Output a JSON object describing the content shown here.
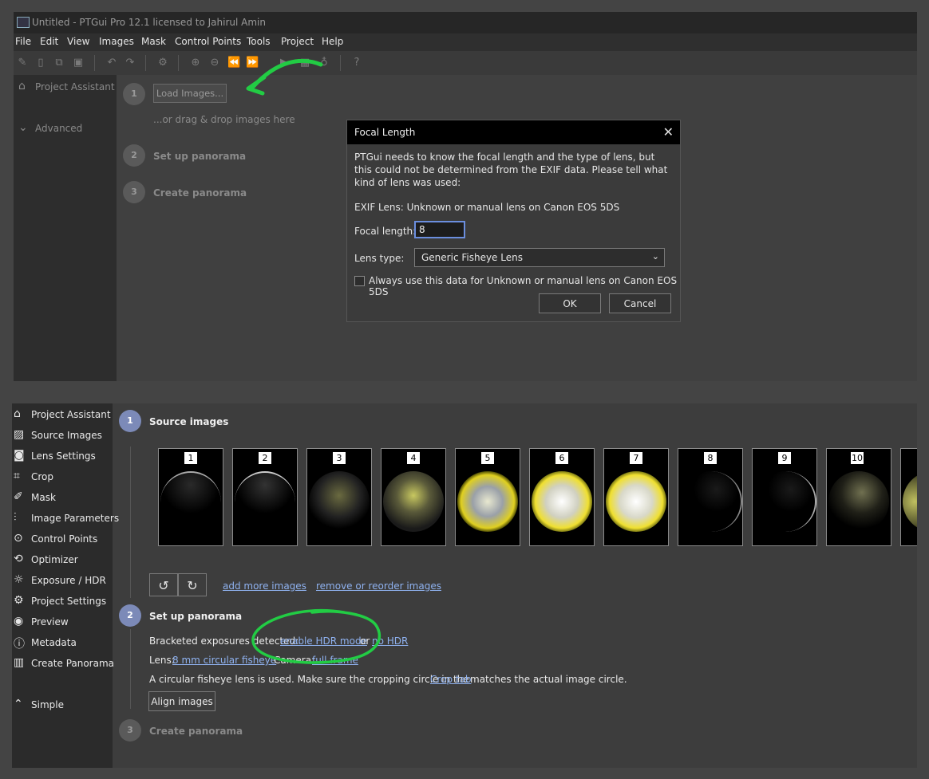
{
  "window": {
    "title": "Untitled - PTGui Pro 12.1 licensed to Jahirul Amin"
  },
  "menu": [
    "File",
    "Edit",
    "View",
    "Images",
    "Mask",
    "Control Points",
    "Tools",
    "Project",
    "Help"
  ],
  "top_sidebar": {
    "project_assistant": "Project Assistant",
    "advanced": "Advanced"
  },
  "top_assistant": {
    "steps": [
      {
        "num": "1",
        "label": "Load Images..."
      },
      {
        "num": "2",
        "label": "Set up panorama"
      },
      {
        "num": "3",
        "label": "Create panorama"
      }
    ],
    "drag_hint": "...or drag & drop images here"
  },
  "dialog": {
    "title": "Focal Length",
    "close": "✕",
    "message": "PTGui needs to know the focal length and the type of lens, but this could not be determined from the EXIF data. Please tell what kind of lens was used:",
    "exif_lens": "EXIF Lens: Unknown or manual lens on Canon EOS 5DS",
    "focal_label": "Focal length:",
    "focal_value": "8",
    "lens_type_label": "Lens type:",
    "lens_type_value": "Generic Fisheye Lens",
    "always_use": "Always use this data for Unknown or manual lens on Canon EOS 5DS",
    "ok": "OK",
    "cancel": "Cancel"
  },
  "bottom_sidebar": [
    {
      "label": "Project Assistant",
      "icon": "home-icon"
    },
    {
      "label": "Source Images",
      "icon": "image-icon"
    },
    {
      "label": "Lens Settings",
      "icon": "camera-icon"
    },
    {
      "label": "Crop",
      "icon": "crop-icon"
    },
    {
      "label": "Mask",
      "icon": "brush-icon"
    },
    {
      "label": "Image Parameters",
      "icon": "sliders-icon"
    },
    {
      "label": "Control Points",
      "icon": "pin-icon"
    },
    {
      "label": "Optimizer",
      "icon": "optimizer-icon"
    },
    {
      "label": "Exposure / HDR",
      "icon": "sun-icon"
    },
    {
      "label": "Project Settings",
      "icon": "gear-icon"
    },
    {
      "label": "Preview",
      "icon": "eye-icon"
    },
    {
      "label": "Metadata",
      "icon": "info-icon"
    },
    {
      "label": "Create Panorama",
      "icon": "panorama-icon"
    },
    {
      "label": "Simple",
      "icon": "chevron-up-icon"
    }
  ],
  "bottom_assistant": {
    "step1": {
      "num": "1",
      "title": "Source images"
    },
    "thumbnails": [
      "1",
      "2",
      "3",
      "4",
      "5",
      "6",
      "7",
      "8",
      "9",
      "10"
    ],
    "add_more": "add more images",
    "remove_reorder": "remove or reorder images",
    "step2": {
      "num": "2",
      "title": "Set up panorama"
    },
    "bracketed_prefix": "Bracketed exposures detected:",
    "enable_hdr": "enable HDR mode",
    "or": "or",
    "no_hdr": "no HDR",
    "lens_prefix": "Lens:",
    "lens_link": "8 mm circular fisheye",
    "camera_prefix": "Camera:",
    "camera_link": "full frame",
    "circular_note_prefix": "A circular fisheye lens is used. Make sure the cropping circle in the",
    "crop_tab": "Crop tab",
    "circular_note_suffix": "matches the actual image circle.",
    "align": "Align images",
    "step3": {
      "num": "3",
      "title": "Create panorama"
    }
  },
  "colors": {
    "accent_step": "#7c8ab8",
    "annotation_green": "#22cc44",
    "link": "#8fb2f0"
  }
}
